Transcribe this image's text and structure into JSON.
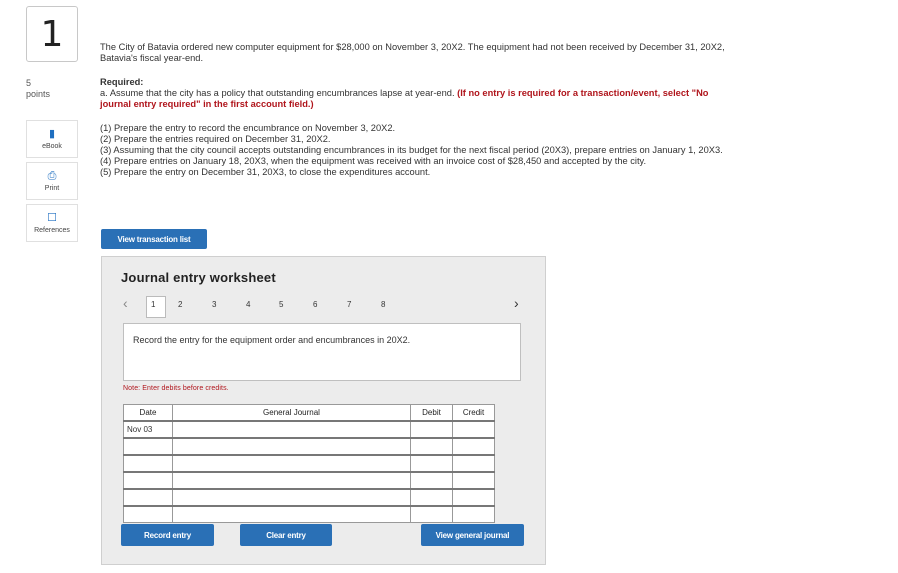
{
  "question": {
    "number": "1",
    "points_value": "5",
    "points_label": "points"
  },
  "tools": [
    {
      "label": "eBook",
      "icon": "book-icon"
    },
    {
      "label": "Print",
      "icon": "printer-icon"
    },
    {
      "label": "References",
      "icon": "document-icon"
    }
  ],
  "problem": {
    "text": "The City of Batavia ordered new computer equipment for $28,000 on November 3, 20X2. The equipment had not been received by December 31, 20X2, Batavia's fiscal year-end.",
    "required_heading": "Required:",
    "part_a": "a. Assume that the city has a policy that outstanding encumbrances lapse at year-end.",
    "part_a_note": "(If no entry is required for a transaction/event, select \"No journal entry required\" in the first account field.)",
    "steps": [
      "(1) Prepare the entry to record the encumbrance on November 3, 20X2.",
      "(2) Prepare the entries required on December 31, 20X2.",
      "(3) Assuming that the city council accepts outstanding encumbrances in its budget for the next fiscal period (20X3), prepare entries on January 1, 20X3.",
      "(4) Prepare entries on January 18, 20X3, when the equipment was received with an invoice cost of $28,450 and accepted by the city.",
      "(5) Prepare the entry on December 31, 20X3, to close the expenditures account."
    ]
  },
  "view_transaction_list_label": "View transaction list",
  "worksheet": {
    "title": "Journal entry worksheet",
    "pages": [
      "1",
      "2",
      "3",
      "4",
      "5",
      "6",
      "7",
      "8"
    ],
    "current_page": "1",
    "instruction": "Record the entry for the equipment order and encumbrances in 20X2.",
    "note": "Note: Enter debits before credits.",
    "columns": {
      "date": "Date",
      "journal": "General Journal",
      "debit": "Debit",
      "credit": "Credit"
    },
    "rows": [
      {
        "date": "Nov 03",
        "account": "",
        "debit": "",
        "credit": ""
      },
      {
        "date": "",
        "account": "",
        "debit": "",
        "credit": ""
      },
      {
        "date": "",
        "account": "",
        "debit": "",
        "credit": ""
      },
      {
        "date": "",
        "account": "",
        "debit": "",
        "credit": ""
      },
      {
        "date": "",
        "account": "",
        "debit": "",
        "credit": ""
      },
      {
        "date": "",
        "account": "",
        "debit": "",
        "credit": ""
      }
    ],
    "buttons": {
      "record": "Record entry",
      "clear": "Clear entry",
      "view_journal": "View general journal"
    }
  },
  "colors": {
    "accent": "#2a70b6",
    "error_red": "#b0151c",
    "panel_bg": "#ececec"
  }
}
